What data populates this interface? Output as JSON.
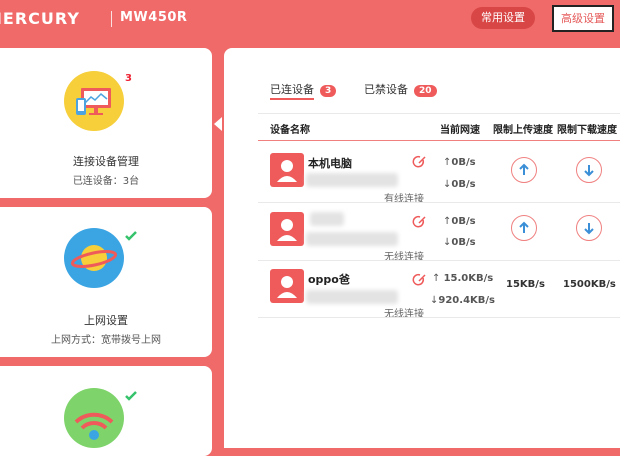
{
  "header": {
    "brand": "MERCURY",
    "model": "MW450R",
    "common_settings": "常用设置",
    "advanced_settings": "高级设置"
  },
  "sidebar": {
    "cards": [
      {
        "title": "连接设备管理",
        "subtitle": "已连设备：3台",
        "badge": "3",
        "icon": "monitor-phone-icon"
      },
      {
        "title": "上网设置",
        "subtitle": "上网方式：宽带拨号上网",
        "icon": "planet-icon",
        "status": "check"
      },
      {
        "title": "",
        "subtitle": "",
        "icon": "wifi-icon",
        "status": "check"
      }
    ]
  },
  "tabs": [
    {
      "label": "已连设备",
      "count": "3",
      "active": true
    },
    {
      "label": "已禁设备",
      "count": "20",
      "active": false
    }
  ],
  "table": {
    "headers": [
      "设备名称",
      "当前网速",
      "限制上传速度",
      "限制下载速度"
    ],
    "rows": [
      {
        "name": "本机电脑",
        "conn": "有线连接",
        "up": "0B/s",
        "down": "0B/s",
        "upload_limit": "",
        "download_limit": ""
      },
      {
        "name": "",
        "conn": "无线连接",
        "up": "0B/s",
        "down": "0B/s",
        "upload_limit": "",
        "download_limit": ""
      },
      {
        "name": "oppo爸",
        "conn": "无线连接",
        "up": "15.0KB/s",
        "down": "920.4KB/s",
        "upload_limit": "15KB/s",
        "download_limit": "1500KB/s"
      }
    ]
  },
  "colors": {
    "accent": "#ef5a5a",
    "background": "#f06a6a",
    "badge": "#ef5a5a"
  }
}
